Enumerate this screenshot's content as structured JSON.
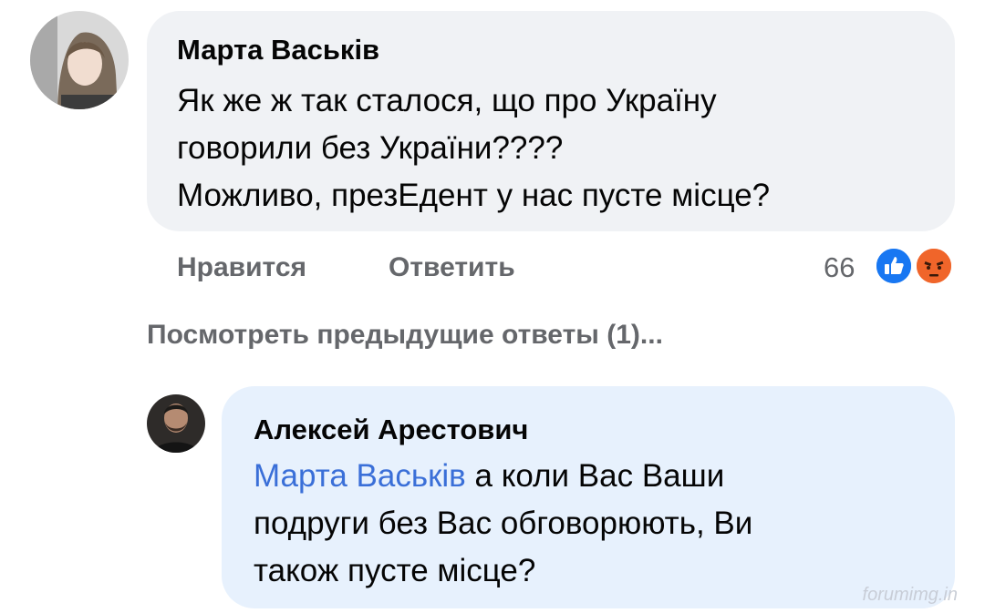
{
  "comment": {
    "author": "Марта Васьків",
    "text_lines": [
      "Як  же ж так сталося, що про Україну",
      "говорили без України????",
      "Можливо, презЕдент у нас пусте місце?"
    ],
    "actions": {
      "like": "Нравится",
      "reply": "Ответить"
    },
    "reaction_count": "66",
    "reactions": [
      "like-reaction",
      "angry-reaction"
    ],
    "colors": {
      "bubble": "#f0f2f5",
      "like": "#1877f2",
      "angry": "#f0652a"
    }
  },
  "view_previous": "Посмотреть предыдущие ответы (1)...",
  "reply": {
    "author": "Алексей Арестович",
    "mention": "Марта Васьків",
    "text_first": "а коли Вас Ваши",
    "text_lines": [
      "подруги без Вас обговорюють, Ви",
      "також пусте місце?"
    ],
    "colors": {
      "bubble": "#e7f1fd",
      "mention": "#3a6fd8"
    }
  },
  "watermark": "forumimg.in"
}
